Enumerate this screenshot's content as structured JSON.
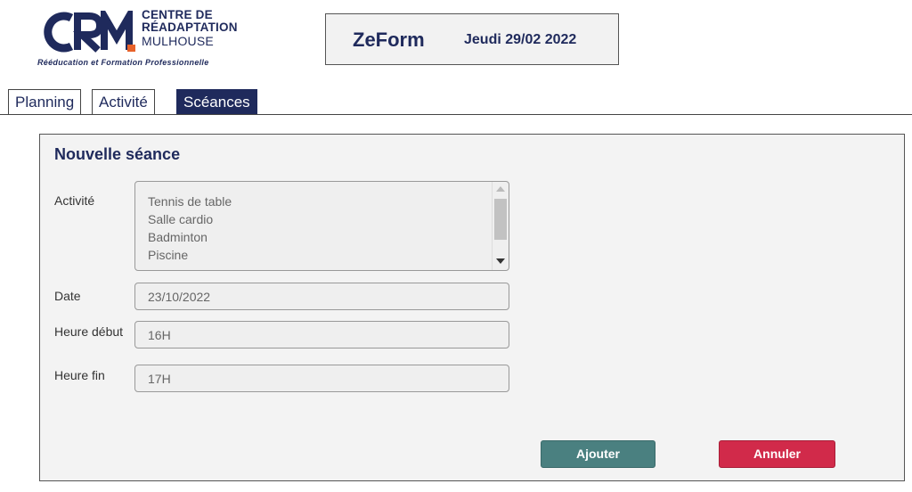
{
  "logo": {
    "line1": "CENTRE DE",
    "line2": "RÉADAPTATION",
    "line3": "MULHOUSE",
    "tagline": "Rééducation et Formation Professionnelle",
    "brand_color": "#1f2a5c",
    "accent_color": "#e8622a"
  },
  "header": {
    "title": "ZeForm",
    "date": "Jeudi 29/02 2022"
  },
  "tabs": [
    {
      "label": "Planning",
      "active": false
    },
    {
      "label": "Activité",
      "active": false
    },
    {
      "label": "Scéances",
      "active": true
    }
  ],
  "form": {
    "title": "Nouvelle séance",
    "activity_label": "Activité",
    "activities": [
      "Tennis de table",
      "Salle cardio",
      "Badminton",
      "Piscine"
    ],
    "date_label": "Date",
    "date_value": "23/10/2022",
    "start_label": "Heure début",
    "start_value": "16H",
    "end_label": "Heure fin",
    "end_value": "17H",
    "add_label": "Ajouter",
    "cancel_label": "Annuler"
  },
  "colors": {
    "add_button": "#4a8080",
    "cancel_button": "#d12a4a"
  }
}
